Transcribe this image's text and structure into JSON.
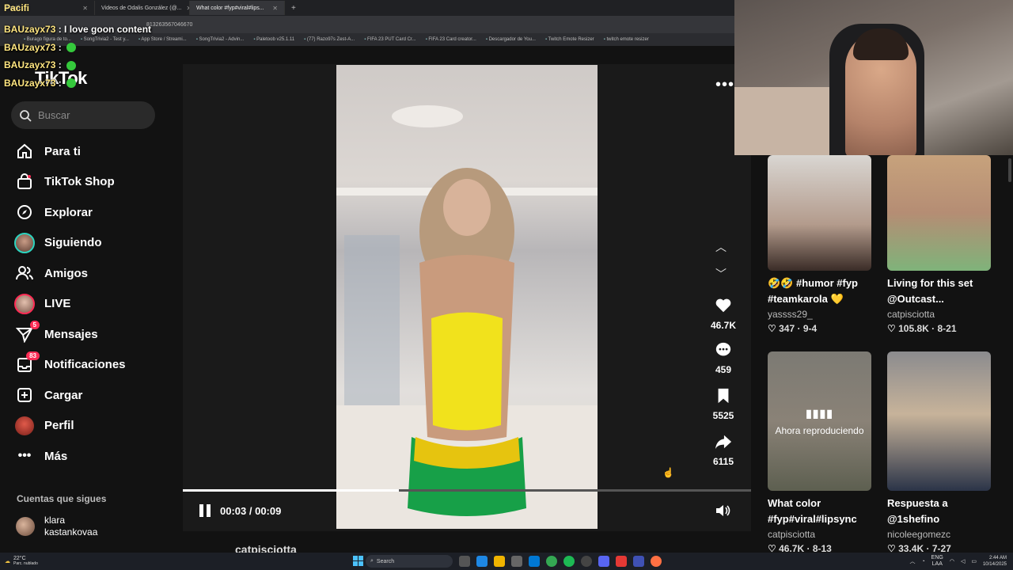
{
  "browser": {
    "tabs": [
      {
        "label": "Pacifi..."
      },
      {
        "label": "Videos de Odalis González (@..."
      },
      {
        "label": "What color #fyp#viral#lips..."
      }
    ],
    "address_fragment": "813263567046670",
    "bookmarks": [
      "Burago figura de to...",
      "SongTrivia2 - Test y...",
      "App Store / Streami...",
      "SongTrivia2 - Advin...",
      "Paletoob v25.1.11",
      "(77) Razo97s Zest-A...",
      "FIFA 23 PUT Card Cr...",
      "FIFA 23 Card creator...",
      "Descargador de You...",
      "Twitch Emote Resizer",
      "twitch emote resizer"
    ]
  },
  "chat": {
    "header": "Pacifi",
    "messages": [
      {
        "user": "BAUzayx73",
        "text": "I love goon content"
      },
      {
        "user": "BAUzayx73",
        "text": ""
      },
      {
        "user": "BAUzayx73",
        "text": ""
      },
      {
        "user": "BAUzayx73",
        "text": ""
      }
    ]
  },
  "sidebar": {
    "logo": "TikTok",
    "search_placeholder": "Buscar",
    "items": [
      {
        "label": "Para ti",
        "icon": "home-icon"
      },
      {
        "label": "TikTok Shop",
        "icon": "shop-icon"
      },
      {
        "label": "Explorar",
        "icon": "compass-icon"
      },
      {
        "label": "Siguiendo",
        "icon": "avatar-icon"
      },
      {
        "label": "Amigos",
        "icon": "friends-icon"
      },
      {
        "label": "LIVE",
        "icon": "live-avatar-icon"
      },
      {
        "label": "Mensajes",
        "icon": "send-icon",
        "badge": "5"
      },
      {
        "label": "Notificaciones",
        "icon": "inbox-icon",
        "badge": "83"
      },
      {
        "label": "Cargar",
        "icon": "upload-icon"
      },
      {
        "label": "Perfil",
        "icon": "profile-icon"
      },
      {
        "label": "Más",
        "icon": "more-icon"
      }
    ],
    "following_title": "Cuentas que sigues",
    "following": [
      {
        "name_line1": "klara",
        "name_line2": "kastankovaa"
      }
    ]
  },
  "player": {
    "time_current": "00:03",
    "time_total": "00:09",
    "progress": 0.38,
    "likes": "46.7K",
    "comments": "459",
    "saves": "5525",
    "shares": "6115",
    "author": "catpisciotta"
  },
  "recommended": [
    {
      "title_line1": "🤣🤣 #humor #fyp",
      "title_line2": "#teamkarola 💛",
      "user": "yassss29_",
      "likes": "347",
      "date": "9-4"
    },
    {
      "title_line1": "Living for this set",
      "title_line2": "@Outcast...",
      "user": "catpisciotta",
      "likes": "105.8K",
      "date": "8-21"
    },
    {
      "title_line1": "What color",
      "title_line2": "#fyp#viral#lipsync",
      "user": "catpisciotta",
      "likes": "46.7K",
      "date": "8-13",
      "now_playing": "Ahora reproduciendo"
    },
    {
      "title_line1": "Respuesta a",
      "title_line2": "@1shefino",
      "user": "nicoleegomezc",
      "likes": "33.4K",
      "date": "7-27"
    }
  ],
  "taskbar": {
    "temp": "22°C",
    "weather": "Parc. nublado",
    "search": "Search",
    "lang": "ENG",
    "region": "LAA",
    "time": "2:44 AM",
    "date": "10/14/2025"
  },
  "colors": {
    "accent": "#fe2c55",
    "bg": "#121212",
    "chat_user": "#ffe680"
  }
}
